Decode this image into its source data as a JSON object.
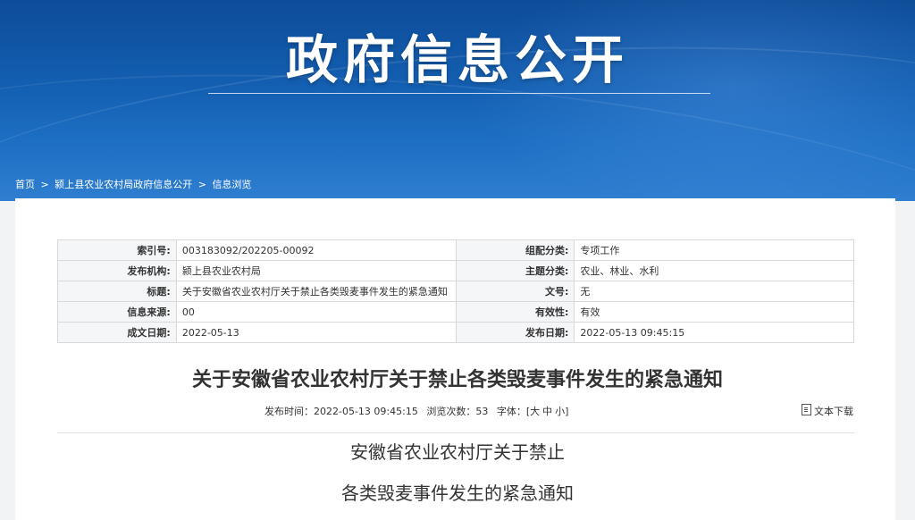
{
  "banner": {
    "title": "政府信息公开"
  },
  "breadcrumb": {
    "items": [
      "首页",
      ">",
      "颍上县农业农村局政府信息公开",
      ">",
      "信息浏览"
    ]
  },
  "meta": {
    "rows": [
      [
        {
          "k": "索引号:",
          "v": "003183092/202205-00092"
        },
        {
          "k": "组配分类:",
          "v": "专项工作"
        }
      ],
      [
        {
          "k": "发布机构:",
          "v": "颍上县农业农村局"
        },
        {
          "k": "主题分类:",
          "v": "农业、林业、水利"
        }
      ],
      [
        {
          "k": "标题:",
          "v": "关于安徽省农业农村厅关于禁止各类毁麦事件发生的紧急通知"
        },
        {
          "k": "文号:",
          "v": "无"
        }
      ],
      [
        {
          "k": "信息来源:",
          "v": "00"
        },
        {
          "k": "有效性:",
          "v": "有效"
        }
      ],
      [
        {
          "k": "成文日期:",
          "v": "2022-05-13"
        },
        {
          "k": "发布日期:",
          "v": "2022-05-13 09:45:15"
        }
      ]
    ]
  },
  "article": {
    "title": "关于安徽省农业农村厅关于禁止各类毁麦事件发生的紧急通知",
    "publish_time": "发布时间：2022-05-13 09:45:15",
    "views": "浏览次数：53",
    "font_label": "字体：[",
    "font_large": "大",
    "font_medium": "中",
    "font_small": "小",
    "font_close": "]",
    "download": "文本下载",
    "body_line1": "安徽省农业农村厅关于禁止",
    "body_line2": "各类毁麦事件发生的紧急通知"
  }
}
